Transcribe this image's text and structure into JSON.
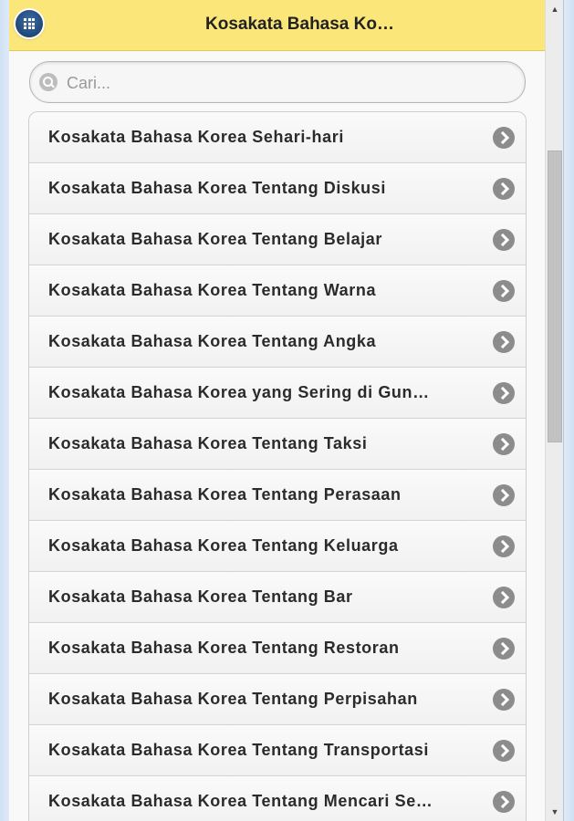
{
  "header": {
    "title": "Kosakata Bahasa Ko…",
    "menu_icon": "grid-icon",
    "background": "#fbe67a"
  },
  "search": {
    "placeholder": "Cari...",
    "value": "",
    "icon": "search-icon"
  },
  "list": {
    "items": [
      {
        "label": "Kosakata Bahasa Korea Sehari-hari"
      },
      {
        "label": "Kosakata Bahasa Korea Tentang Diskusi"
      },
      {
        "label": "Kosakata Bahasa Korea Tentang Belajar"
      },
      {
        "label": "Kosakata Bahasa Korea Tentang Warna"
      },
      {
        "label": "Kosakata Bahasa Korea Tentang Angka"
      },
      {
        "label": "Kosakata Bahasa Korea yang Sering di Gun…"
      },
      {
        "label": "Kosakata Bahasa Korea Tentang Taksi"
      },
      {
        "label": "Kosakata Bahasa Korea Tentang Perasaan"
      },
      {
        "label": "Kosakata Bahasa Korea Tentang Keluarga"
      },
      {
        "label": "Kosakata Bahasa Korea Tentang Bar"
      },
      {
        "label": "Kosakata Bahasa Korea Tentang Restoran"
      },
      {
        "label": "Kosakata Bahasa Korea Tentang Perpisahan"
      },
      {
        "label": "Kosakata Bahasa Korea Tentang Transportasi"
      },
      {
        "label": "Kosakata Bahasa Korea Tentang Mencari Se…"
      }
    ],
    "item_icon": "chevron-right-icon"
  },
  "scrollbar": {
    "up_glyph": "▲",
    "down_glyph": "▼"
  }
}
